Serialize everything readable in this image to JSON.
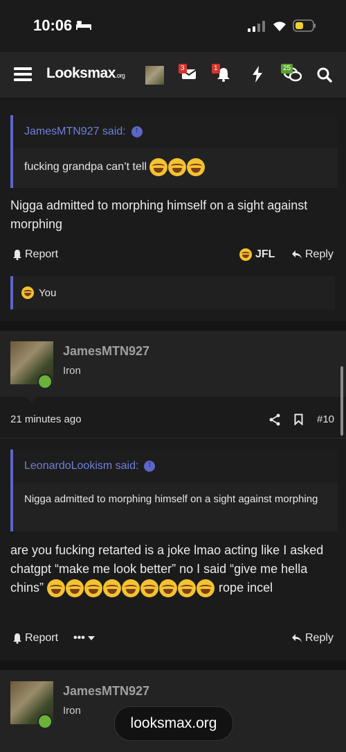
{
  "status": {
    "time": "10:06"
  },
  "nav": {
    "logo_main": "Looksmax",
    "logo_suffix": ".org",
    "badges": {
      "messages": "3",
      "alerts": "1",
      "activity": "25"
    }
  },
  "posts": [
    {
      "quote": {
        "author": "JamesMTN927 said:",
        "text": "fucking grandpa can’t tell"
      },
      "body": "Nigga admitted to morphing himself on a sight against morphing",
      "actions": {
        "report": "Report",
        "jfl": "JFL",
        "reply": "Reply"
      },
      "reaction_user": "You"
    },
    {
      "author": "JamesMTN927",
      "title": "Iron",
      "time": "21 minutes ago",
      "number": "#10",
      "quote": {
        "author": "LeonardoLookism said:",
        "text": "Nigga admitted to morphing himself on a sight against morphing"
      },
      "body_part1": "are you fucking retarted is a joke lmao acting like I asked chatgpt “make me look better” no I said “give me hella chins”",
      "body_part2": "rope incel",
      "actions": {
        "report": "Report",
        "more": "•••",
        "reply": "Reply"
      }
    },
    {
      "author": "JamesMTN927",
      "title": "Iron"
    }
  ],
  "toast": "looksmax.org"
}
